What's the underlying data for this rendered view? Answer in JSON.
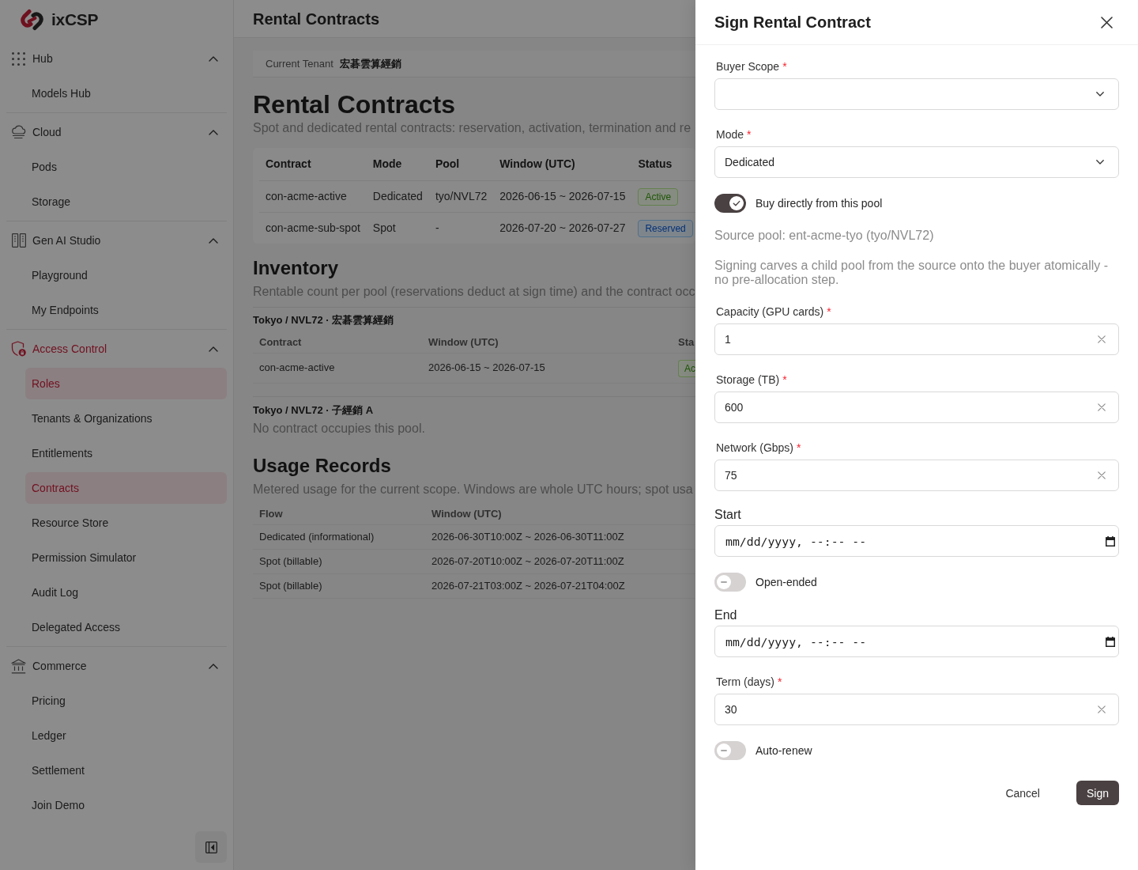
{
  "sidebar": {
    "brand": "ixCSP",
    "groups": [
      {
        "label": "Hub",
        "expanded": true,
        "active": false,
        "items": [
          {
            "label": "Models Hub",
            "selected": false
          }
        ]
      },
      {
        "label": "Cloud",
        "expanded": true,
        "active": false,
        "items": [
          {
            "label": "Pods",
            "selected": false
          },
          {
            "label": "Storage",
            "selected": false
          }
        ]
      },
      {
        "label": "Gen AI Studio",
        "expanded": true,
        "active": false,
        "items": [
          {
            "label": "Playground",
            "selected": false
          },
          {
            "label": "My Endpoints",
            "selected": false
          }
        ]
      },
      {
        "label": "Access Control",
        "expanded": true,
        "active": true,
        "items": [
          {
            "label": "Roles",
            "selected": true
          },
          {
            "label": "Tenants & Organizations",
            "selected": false
          },
          {
            "label": "Entitlements",
            "selected": false
          },
          {
            "label": "Contracts",
            "selected": true
          },
          {
            "label": "Resource Store",
            "selected": false
          },
          {
            "label": "Permission Simulator",
            "selected": false
          },
          {
            "label": "Audit Log",
            "selected": false
          },
          {
            "label": "Delegated Access",
            "selected": false
          }
        ]
      },
      {
        "label": "Commerce",
        "expanded": true,
        "active": false,
        "items": [
          {
            "label": "Pricing",
            "selected": false
          },
          {
            "label": "Ledger",
            "selected": false
          },
          {
            "label": "Settlement",
            "selected": false
          },
          {
            "label": "Join Demo",
            "selected": false
          }
        ]
      }
    ]
  },
  "header": {
    "title": "Rental Contracts"
  },
  "tenant": {
    "label": "Current Tenant",
    "value": "宏碁雲算經銷"
  },
  "contracts": {
    "title": "Rental Contracts",
    "subtitle": "Spot and dedicated rental contracts: reservation, activation, termination and re",
    "table": {
      "columns": [
        "Contract",
        "Mode",
        "Pool",
        "Window (UTC)",
        "Status"
      ],
      "rows": [
        {
          "cells": [
            "con-acme-active",
            "Dedicated",
            "tyo/NVL72",
            "2026-06-15 ~ 2026-07-15"
          ],
          "status": {
            "label": "Active",
            "kind": "success"
          }
        },
        {
          "cells": [
            "con-acme-sub-spot",
            "Spot",
            "-",
            "2026-07-20 ~ 2026-07-27"
          ],
          "status": {
            "label": "Reserved",
            "kind": "info"
          }
        }
      ]
    }
  },
  "inventory": {
    "title": "Inventory",
    "subtitle": "Rentable count per pool (reservations deduct at sign time) and the contract occ",
    "pools": [
      {
        "title": "Tokyo / NVL72 · 宏碁雲算經銷",
        "table": {
          "columns": [
            "Contract",
            "Window (UTC)",
            "Sta"
          ],
          "rows": [
            {
              "cells": [
                "con-acme-active",
                "2026-06-15 ~ 2026-07-15"
              ],
              "status": {
                "label": "Ac",
                "kind": "success"
              }
            }
          ]
        }
      },
      {
        "title": "Tokyo / NVL72 · 子經銷 A",
        "empty_text": "No contract occupies this pool."
      }
    ]
  },
  "usage": {
    "title": "Usage Records",
    "subtitle": "Metered usage for the current scope. Windows are whole UTC hours; spot usa",
    "table": {
      "columns": [
        "Flow",
        "Window (UTC)"
      ],
      "rows": [
        {
          "cells": [
            "Dedicated (informational)",
            "2026-06-30T10:00Z ~ 2026-06-30T11:00Z"
          ]
        },
        {
          "cells": [
            "Spot (billable)",
            "2026-07-20T10:00Z ~ 2026-07-20T11:00Z"
          ]
        },
        {
          "cells": [
            "Spot (billable)",
            "2026-07-21T03:00Z ~ 2026-07-21T04:00Z"
          ]
        }
      ]
    }
  },
  "drawer": {
    "title": "Sign Rental Contract",
    "fields": [
      {
        "kind": "select",
        "label": "Buyer Scope",
        "required_mark": "*"
      },
      {
        "kind": "select",
        "label": "Mode",
        "required_mark": "*",
        "value": "Dedicated"
      },
      {
        "kind": "switch",
        "label": "Buy directly from this pool",
        "on": true
      },
      {
        "kind": "note",
        "text": "Source pool: ent-acme-tyo (tyo/NVL72)"
      },
      {
        "kind": "note",
        "text": "Signing carves a child pool from the source onto the buyer atomically - no pre-allocation step."
      },
      {
        "kind": "number",
        "label": "Capacity (GPU cards)",
        "required_mark": "*",
        "value": "1"
      },
      {
        "kind": "number",
        "label": "Storage (TB)",
        "required_mark": "*",
        "value": "600"
      },
      {
        "kind": "number",
        "label": "Network (Gbps)",
        "required_mark": "*",
        "value": "75"
      },
      {
        "kind": "datetime",
        "label": "Start",
        "placeholder": "mm/dd/yyyy, --:-- --"
      },
      {
        "kind": "switch",
        "label": "Open-ended",
        "on": false
      },
      {
        "kind": "datetime",
        "label": "End",
        "placeholder": "mm/dd/yyyy, --:-- --"
      },
      {
        "kind": "number",
        "label": "Term (days)",
        "required_mark": "*",
        "value": "30"
      },
      {
        "kind": "switch",
        "label": "Auto-renew",
        "on": false
      }
    ],
    "actions": [
      {
        "label": "Cancel",
        "kind": "text"
      },
      {
        "label": "Sign",
        "kind": "primary"
      }
    ]
  }
}
